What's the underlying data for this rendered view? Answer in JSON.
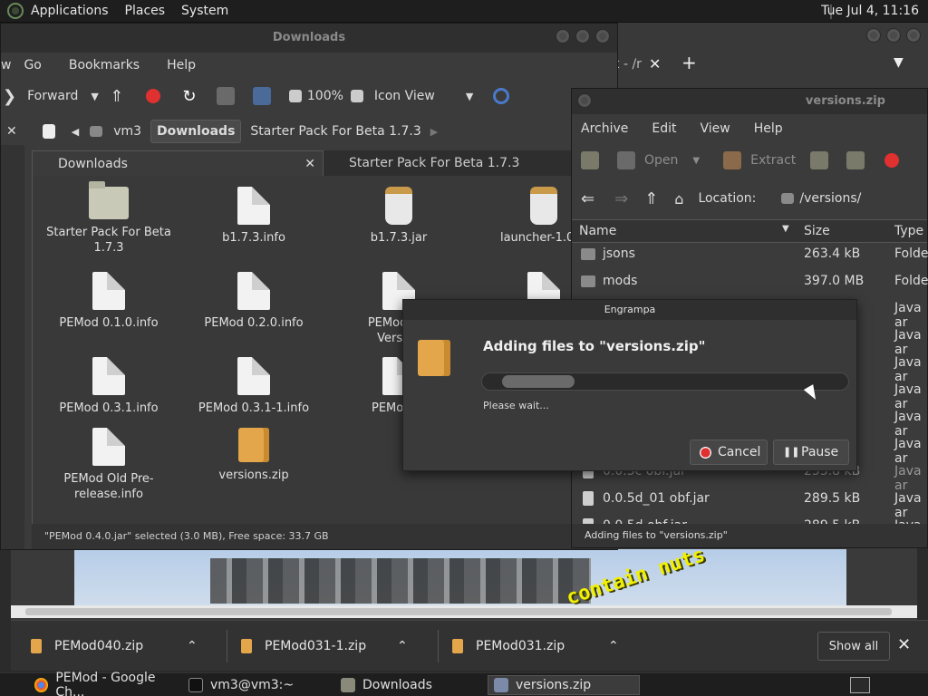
{
  "top_panel": {
    "menus": [
      "Applications",
      "Places",
      "System"
    ],
    "clock": "Tue Jul  4, 11:16"
  },
  "chrome": {
    "tab_fragment": "t - /r",
    "shelf": {
      "items": [
        "PEMod040.zip",
        "PEMod031-1.zip",
        "PEMod031.zip"
      ],
      "show_all": "Show all"
    },
    "splash": "contain nuts"
  },
  "file_manager": {
    "title": "Downloads",
    "menus": [
      "Go",
      "Bookmarks",
      "Help"
    ],
    "forward": "Forward",
    "zoom": "100%",
    "view_mode": "Icon View",
    "path": [
      "vm3",
      "Downloads",
      "Starter Pack For Beta 1.7.3"
    ],
    "tabs": [
      "Downloads",
      "Starter Pack For Beta 1.7.3"
    ],
    "files": [
      "Starter Pack For Beta 1.7.3",
      "b1.7.3.info",
      "b1.7.3.jar",
      "launcher-1.09_",
      "PEMod 0.1.0.info",
      "PEMod 0.2.0.info",
      "PEMod 0.3",
      "Version",
      "PEMod 0.3.1.info",
      "PEMod 0.3.1-1.info",
      "PEMod 0.",
      "PEMod Old Pre-release.info",
      "versions.zip"
    ],
    "status": "\"PEMod 0.4.0.jar\" selected (3.0 MB), Free space: 33.7 GB"
  },
  "archive": {
    "title": "versions.zip",
    "menus": [
      "Archive",
      "Edit",
      "View",
      "Help"
    ],
    "toolbar": {
      "open": "Open",
      "extract": "Extract"
    },
    "location_label": "Location:",
    "location": "/versions/",
    "headers": {
      "name": "Name",
      "size": "Size",
      "type": "Type"
    },
    "rows": [
      {
        "name": "jsons",
        "size": "263.4 kB",
        "type": "Folder"
      },
      {
        "name": "mods",
        "size": "397.0 MB",
        "type": "Folder"
      },
      {
        "name": "",
        "size": "",
        "type": "Java ar"
      },
      {
        "name": "",
        "size": "",
        "type": "Java ar"
      },
      {
        "name": "",
        "size": "",
        "type": "Java ar"
      },
      {
        "name": "",
        "size": "",
        "type": "Java ar"
      },
      {
        "name": "",
        "size": "",
        "type": "Java ar"
      },
      {
        "name": "",
        "size": "",
        "type": "Java ar"
      },
      {
        "name": "0.0.5c obf.jar",
        "size": "255.8 kB",
        "type": "Java ar"
      },
      {
        "name": "0.0.5d_01 obf.jar",
        "size": "289.5 kB",
        "type": "Java ar"
      },
      {
        "name": "0.0.5d obf.jar",
        "size": "289.5 kB",
        "type": "Java ar"
      }
    ],
    "status": "Adding files to \"versions.zip\""
  },
  "dialog": {
    "title": "Engrampa",
    "heading": "Adding files to \"versions.zip\"",
    "wait": "Please wait...",
    "cancel": "Cancel",
    "pause": "Pause"
  },
  "taskbar": [
    "PEMod - Google Ch...",
    "vm3@vm3:~",
    "Downloads",
    "versions.zip"
  ]
}
